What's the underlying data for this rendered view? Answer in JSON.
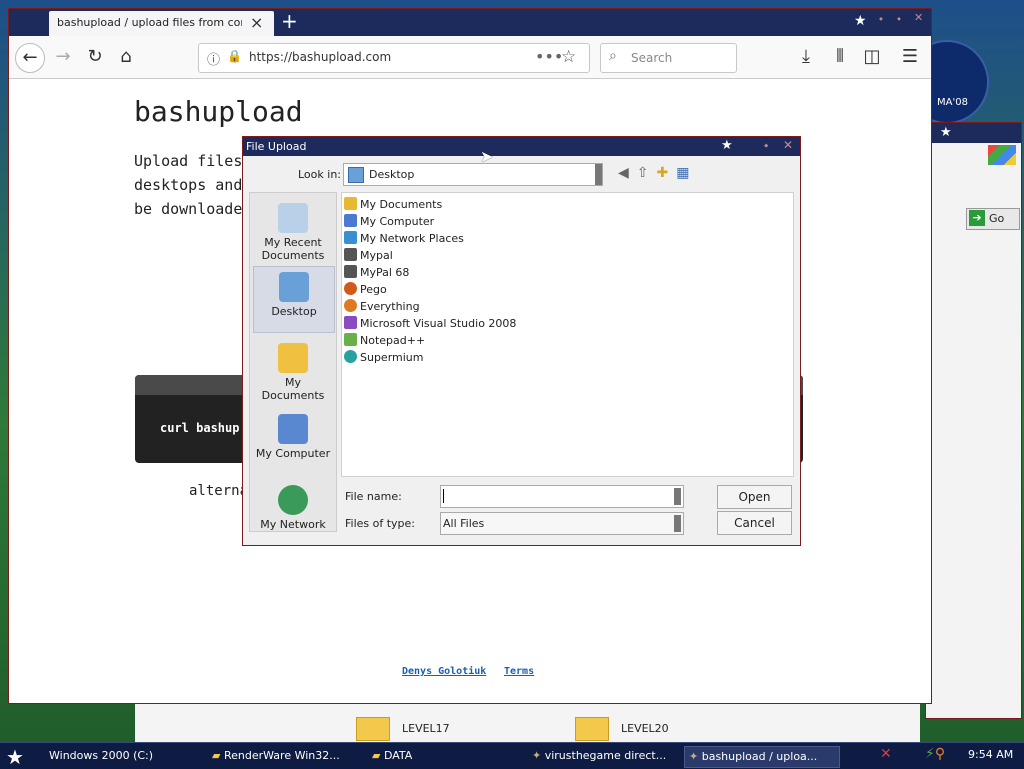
{
  "desktop": {
    "badge_text": "MA'08",
    "bg_go_label": "Go"
  },
  "browser": {
    "tab_title": "bashupload / upload files from command line",
    "tab_close": "×",
    "new_tab": "+",
    "url": "https://bashupload.com",
    "url_more": "•••",
    "search_placeholder": "Search",
    "page": {
      "heading": "bashupload",
      "description": "Upload files\ndesktops and\nbe downloaded",
      "code": "curl bashupload.com -T your_file.txt",
      "alt_text": "alternatively",
      "footer_author": "Denys Golotiuk",
      "footer_terms": "Terms"
    }
  },
  "dialog": {
    "title": "File Upload",
    "look_in_label": "Look in:",
    "look_in_value": "Desktop",
    "places": [
      {
        "label": "My Recent Documents",
        "icon": "recent-documents-icon"
      },
      {
        "label": "Desktop",
        "icon": "desktop-icon"
      },
      {
        "label": "My Documents",
        "icon": "my-documents-icon"
      },
      {
        "label": "My Computer",
        "icon": "my-computer-icon"
      },
      {
        "label": "My Network",
        "icon": "my-network-icon"
      }
    ],
    "files": [
      {
        "name": "My Documents",
        "color": "#e8b830"
      },
      {
        "name": "My Computer",
        "color": "#4a7bd0"
      },
      {
        "name": "My Network Places",
        "color": "#3a8fd0"
      },
      {
        "name": "Mypal",
        "color": "#555555"
      },
      {
        "name": "MyPal 68",
        "color": "#555555"
      },
      {
        "name": "Pego",
        "color": "#d05a1a"
      },
      {
        "name": "Everything",
        "color": "#e07a20"
      },
      {
        "name": "Microsoft Visual Studio 2008",
        "color": "#8a4ac0"
      },
      {
        "name": "Notepad++",
        "color": "#6ab04a"
      },
      {
        "name": "Supermium",
        "color": "#2aa0a0"
      }
    ],
    "file_name_label": "File name:",
    "file_name_value": "",
    "files_of_type_label": "Files of type:",
    "files_of_type_value": "All Files",
    "open_label": "Open",
    "cancel_label": "Cancel"
  },
  "folders": {
    "level17": "LEVEL17",
    "level20": "LEVEL20"
  },
  "taskbar": {
    "tasks": [
      {
        "label": "Windows 2000 (C:)"
      },
      {
        "label": "RenderWare Win32..."
      },
      {
        "label": "DATA"
      },
      {
        "label": "virusthegame direct..."
      },
      {
        "label": "bashupload / uploa..."
      }
    ],
    "clock": "9:54 AM"
  }
}
